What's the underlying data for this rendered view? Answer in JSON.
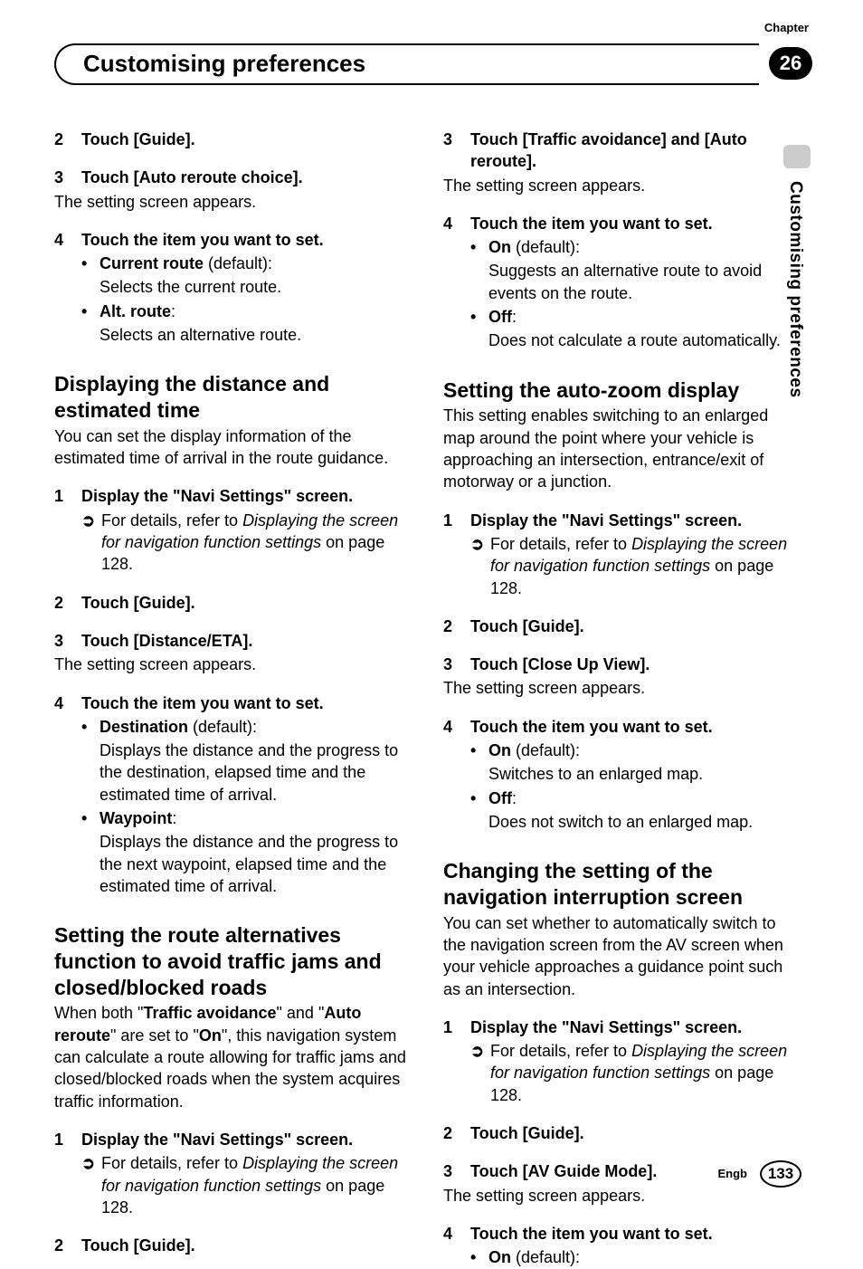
{
  "chapter_label": "Chapter",
  "chapter_num": "26",
  "page_title": "Customising preferences",
  "vert_label": "Customising preferences",
  "footer": {
    "lang": "Engb",
    "page": "133"
  },
  "left": {
    "s1": {
      "num": "2",
      "text": "Touch [Guide]."
    },
    "s2": {
      "num": "3",
      "text": "Touch [Auto reroute choice]."
    },
    "s2_note": "The setting screen appears.",
    "s3": {
      "num": "4",
      "text": "Touch the item you want to set."
    },
    "s3_b1_label": "Current route",
    "s3_b1_suffix": " (default):",
    "s3_b1_desc": "Selects the current route.",
    "s3_b2_label": "Alt. route",
    "s3_b2_suffix": ":",
    "s3_b2_desc": "Selects an alternative route.",
    "h1": "Displaying the distance and estimated time",
    "h1_intro": "You can set the display information of the estimated time of arrival in the route guidance.",
    "h1_s1": {
      "num": "1",
      "text": "Display the \"Navi Settings\" screen."
    },
    "h1_ref_prefix": "For details, refer to ",
    "h1_ref_em": "Displaying the screen for navigation function settings",
    "h1_ref_suffix": " on page 128.",
    "h1_s2": {
      "num": "2",
      "text": "Touch [Guide]."
    },
    "h1_s3": {
      "num": "3",
      "text": "Touch [Distance/ETA]."
    },
    "h1_s3_note": "The setting screen appears.",
    "h1_s4": {
      "num": "4",
      "text": "Touch the item you want to set."
    },
    "h1_b1_label": "Destination",
    "h1_b1_suffix": " (default):",
    "h1_b1_desc": "Displays the distance and the progress to the destination, elapsed time and the estimated time of arrival.",
    "h1_b2_label": "Waypoint",
    "h1_b2_suffix": ":",
    "h1_b2_desc": "Displays the distance and the progress to the next waypoint, elapsed time and the estimated time of arrival.",
    "h2": "Setting the route alternatives function to avoid traffic jams and closed/blocked roads",
    "h2_intro_1": "When both \"",
    "h2_intro_b1": "Traffic avoidance",
    "h2_intro_2": "\" and \"",
    "h2_intro_b2": "Auto reroute",
    "h2_intro_3": "\" are set to \"",
    "h2_intro_b3": "On",
    "h2_intro_4": "\", this navigation system can calculate a route allowing for traffic jams and closed/blocked roads when the system acquires traffic information.",
    "h2_s1": {
      "num": "1",
      "text": "Display the \"Navi Settings\" screen."
    },
    "h2_ref_prefix": "For details, refer to ",
    "h2_ref_em": "Displaying the screen for navigation function settings",
    "h2_ref_suffix": " on page 128.",
    "h2_s2": {
      "num": "2",
      "text": "Touch [Guide]."
    }
  },
  "right": {
    "s1": {
      "num": "3",
      "text": "Touch [Traffic avoidance] and [Auto reroute]."
    },
    "s1_note": "The setting screen appears.",
    "s2": {
      "num": "4",
      "text": "Touch the item you want to set."
    },
    "s2_b1_label": "On",
    "s2_b1_suffix": " (default):",
    "s2_b1_desc": "Suggests an alternative route to avoid events on the route.",
    "s2_b2_label": "Off",
    "s2_b2_suffix": ":",
    "s2_b2_desc": "Does not calculate a route automatically.",
    "h1": "Setting the auto-zoom display",
    "h1_intro": "This setting enables switching to an enlarged map around the point where your vehicle is approaching an intersection, entrance/exit of motorway or a junction.",
    "h1_s1": {
      "num": "1",
      "text": "Display the \"Navi Settings\" screen."
    },
    "h1_ref_prefix": "For details, refer to ",
    "h1_ref_em": "Displaying the screen for navigation function settings",
    "h1_ref_suffix": " on page 128.",
    "h1_s2": {
      "num": "2",
      "text": "Touch [Guide]."
    },
    "h1_s3": {
      "num": "3",
      "text": "Touch [Close Up View]."
    },
    "h1_s3_note": "The setting screen appears.",
    "h1_s4": {
      "num": "4",
      "text": "Touch the item you want to set."
    },
    "h1_b1_label": "On",
    "h1_b1_suffix": " (default):",
    "h1_b1_desc": "Switches to an enlarged map.",
    "h1_b2_label": "Off",
    "h1_b2_suffix": ":",
    "h1_b2_desc": "Does not switch to an enlarged map.",
    "h2": "Changing the setting of the navigation interruption screen",
    "h2_intro": "You can set whether to automatically switch to the navigation screen from the AV screen when your vehicle approaches a guidance point such as an intersection.",
    "h2_s1": {
      "num": "1",
      "text": "Display the \"Navi Settings\" screen."
    },
    "h2_ref_prefix": "For details, refer to ",
    "h2_ref_em": "Displaying the screen for navigation function settings",
    "h2_ref_suffix": " on page 128.",
    "h2_s2": {
      "num": "2",
      "text": "Touch [Guide]."
    },
    "h2_s3": {
      "num": "3",
      "text": "Touch [AV Guide Mode]."
    },
    "h2_s3_note": "The setting screen appears.",
    "h2_s4": {
      "num": "4",
      "text": "Touch the item you want to set."
    },
    "h2_b1_label": "On",
    "h2_b1_suffix": " (default):"
  }
}
